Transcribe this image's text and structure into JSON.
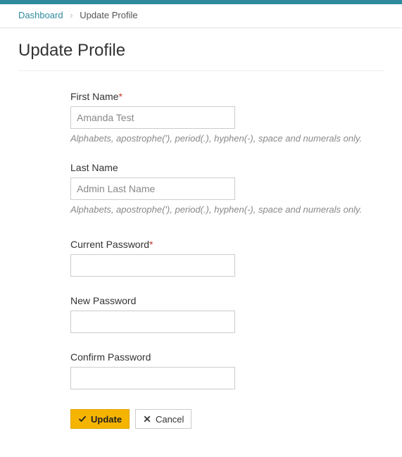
{
  "breadcrumb": {
    "root": "Dashboard",
    "current": "Update Profile"
  },
  "page": {
    "title": "Update Profile"
  },
  "form": {
    "first_name": {
      "label": "First Name",
      "value": "Amanda Test",
      "hint": "Alphabets, apostrophe('), period(.), hyphen(-), space and numerals only."
    },
    "last_name": {
      "label": "Last Name",
      "value": "Admin Last Name",
      "hint": "Alphabets, apostrophe('), period(.), hyphen(-), space and numerals only."
    },
    "current_password": {
      "label": "Current Password",
      "value": ""
    },
    "new_password": {
      "label": "New Password",
      "value": ""
    },
    "confirm_password": {
      "label": "Confirm Password",
      "value": ""
    }
  },
  "buttons": {
    "update": "Update",
    "cancel": "Cancel"
  }
}
